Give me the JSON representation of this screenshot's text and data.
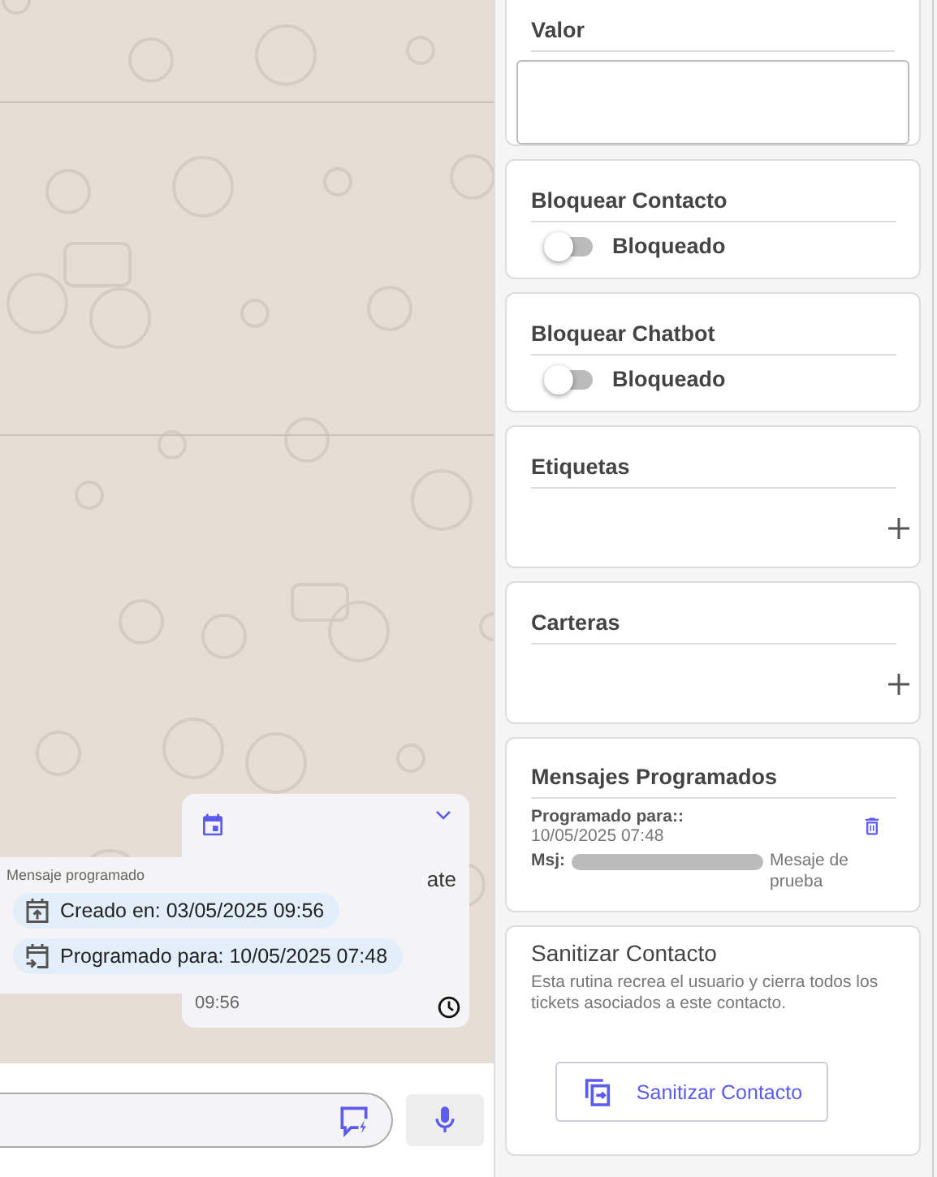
{
  "chat": {
    "bubble": {
      "partial_text": "ate",
      "time": "09:56"
    },
    "overlay": {
      "title": "Mensaje programado",
      "chips": [
        {
          "kind": "created",
          "text": "Creado en: 03/05/2025 09:56"
        },
        {
          "kind": "scheduled",
          "text": "Programado para: 10/05/2025 07:48"
        }
      ]
    }
  },
  "sidebar": {
    "valor": {
      "label": "Valor"
    },
    "toggles": [
      {
        "title": "Bloquear Contacto",
        "label": "Bloqueado",
        "on": false
      },
      {
        "title": "Bloquear Chatbot",
        "label": "Bloqueado",
        "on": false
      }
    ],
    "add_sections": [
      {
        "title": "Etiquetas"
      },
      {
        "title": "Carteras"
      }
    ],
    "scheduled": {
      "title": "Mensajes Programados",
      "items": [
        {
          "label": "Programado para::",
          "date": "10/05/2025 07:48",
          "msg_label": "Msj:",
          "message": "Mesaje de prueba"
        }
      ]
    },
    "sanitize": {
      "title": "Sanitizar Contacto",
      "description": "Esta rutina recrea el usuario y cierra todos los tickets asociados a este contacto.",
      "button": "Sanitizar Contacto"
    }
  }
}
